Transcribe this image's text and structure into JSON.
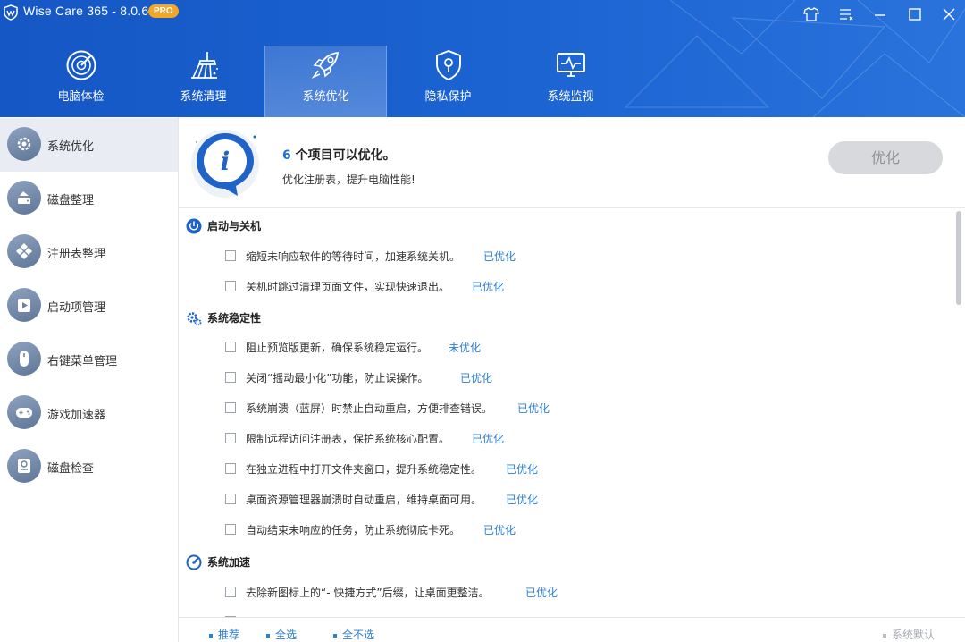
{
  "app": {
    "title": "Wise Care 365 - 8.0.6",
    "badge": "PRO"
  },
  "colors": {
    "header": "#1b64d2",
    "accent": "#2b7fd6",
    "badge": "#f5a623"
  },
  "window_controls": [
    "skin-icon",
    "menu-icon",
    "minimize-icon",
    "maximize-icon",
    "close-icon"
  ],
  "tabs": [
    {
      "label": "电脑体检",
      "icon": "radar-icon"
    },
    {
      "label": "系统清理",
      "icon": "broom-icon"
    },
    {
      "label": "系统优化",
      "icon": "rocket-icon",
      "active": true
    },
    {
      "label": "隐私保护",
      "icon": "shield-lock-icon"
    },
    {
      "label": "系统监视",
      "icon": "monitor-pulse-icon"
    }
  ],
  "sidebar": {
    "items": [
      {
        "label": "系统优化",
        "icon": "gear-icon",
        "active": true
      },
      {
        "label": "磁盘整理",
        "icon": "disk-defrag-icon"
      },
      {
        "label": "注册表整理",
        "icon": "registry-icon"
      },
      {
        "label": "启动项管理",
        "icon": "startup-icon"
      },
      {
        "label": "右键菜单管理",
        "icon": "mouse-icon"
      },
      {
        "label": "游戏加速器",
        "icon": "gamepad-icon"
      },
      {
        "label": "磁盘检查",
        "icon": "disk-check-icon"
      }
    ]
  },
  "info": {
    "count": "6",
    "title_suffix": "个项目可以优化。",
    "subtitle": "优化注册表，提升电脑性能!",
    "button": "优化"
  },
  "sections": [
    {
      "title": "启动与关机",
      "icon": "power-icon",
      "items": [
        {
          "text": "缩短未响应软件的等待时间，加速系统关机。",
          "status": "已优化"
        },
        {
          "text": "关机时跳过清理页面文件，实现快速退出。",
          "status": "已优化"
        }
      ]
    },
    {
      "title": "系统稳定性",
      "icon": "gears-icon",
      "items": [
        {
          "text": "阻止预览版更新，确保系统稳定运行。",
          "status": "未优化"
        },
        {
          "text": "关闭“摇动最小化”功能，防止误操作。",
          "status": "已优化"
        },
        {
          "text": "系统崩溃（蓝屏）时禁止自动重启，方便排查错误。",
          "status": "已优化"
        },
        {
          "text": "限制远程访问注册表，保护系统核心配置。",
          "status": "已优化"
        },
        {
          "text": "在独立进程中打开文件夹窗口，提升系统稳定性。",
          "status": "已优化"
        },
        {
          "text": "桌面资源管理器崩溃时自动重启，维持桌面可用。",
          "status": "已优化"
        },
        {
          "text": "自动结束未响应的任务，防止系统彻底卡死。",
          "status": "已优化"
        }
      ]
    },
    {
      "title": "系统加速",
      "icon": "speedometer-icon",
      "items": [
        {
          "text": "去除新图标上的“- 快捷方式”后缀，让桌面更整洁。",
          "status": "已优化"
        }
      ]
    }
  ],
  "footer": {
    "recommend": "推荐",
    "select_all": "全选",
    "select_none": "全不选",
    "default": "系统默认"
  }
}
